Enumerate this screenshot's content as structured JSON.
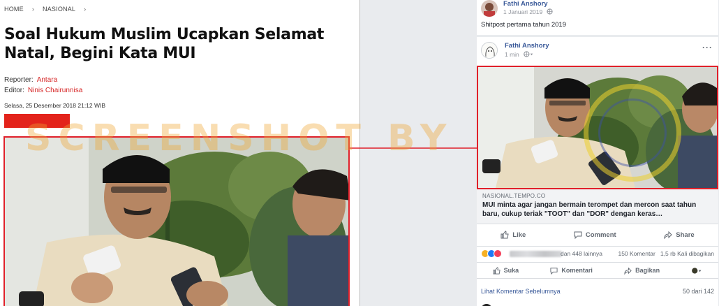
{
  "article": {
    "breadcrumb": [
      "HOME",
      "NASIONAL"
    ],
    "breadcrumb_separator": "›",
    "title": "Soal Hukum Muslim Ucapkan Selamat Natal, Begini Kata MUI",
    "reporter_label": "Reporter:",
    "reporter": "Antara",
    "editor_label": "Editor:",
    "editor": "Ninis Chairunnisa",
    "date": "Selasa, 25 Desember 2018 21:12 WIB",
    "accent_color": "#e3231b"
  },
  "post1": {
    "author": "Fathi Anshory",
    "time": "1 Januari 2019",
    "text": "Shitpost pertama tahun 2019",
    "privacy_icon": "globe-icon"
  },
  "post2": {
    "author": "Fathi Anshory",
    "time": "1 min",
    "more_label": "···",
    "link_domain": "NASIONAL.TEMPO.CO",
    "link_title": "MUI minta agar jangan bermain terompet dan mercon saat tahun baru, cukup teriak \"TOOT\" dan \"DOR\" dengan keras…",
    "actions": {
      "like": "Like",
      "comment": "Comment",
      "share": "Share"
    },
    "reactions_others": "dan 448 lainnya",
    "comments_count": "150 Komentar",
    "shares_count": "1,5 rb Kali dibagikan",
    "subactions": {
      "like": "Suka",
      "comment": "Komentari",
      "share": "Bagikan"
    },
    "prev_comments": "Lihat Komentar Sebelumnya",
    "comment_progress": "50 dari 142"
  },
  "watermark": "SCREENSHOT BY",
  "colors": {
    "facebook_blue": "#385898",
    "highlight_red": "#e0202a",
    "watermark": "#f0a632"
  }
}
